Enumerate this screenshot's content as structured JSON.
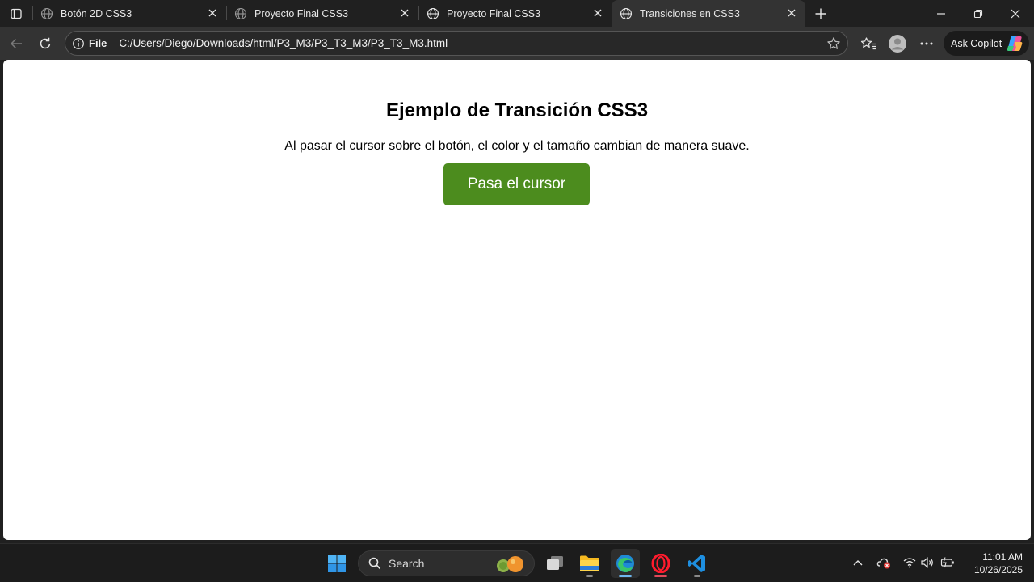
{
  "browser": {
    "tabs": [
      {
        "title": "Botón 2D CSS3",
        "active": false
      },
      {
        "title": "Proyecto Final CSS3",
        "active": false
      },
      {
        "title": "Proyecto Final CSS3",
        "active": false
      },
      {
        "title": "Transiciones en CSS3",
        "active": true
      }
    ],
    "address": {
      "scheme_label": "File",
      "url": "C:/Users/Diego/Downloads/html/P3_M3/P3_T3_M3/P3_T3_M3.html"
    },
    "copilot_label": "Ask Copilot"
  },
  "page": {
    "heading": "Ejemplo de Transición CSS3",
    "description": "Al pasar el cursor sobre el botón, el color y el tamaño cambian de manera suave.",
    "button_label": "Pasa el cursor",
    "button_color": "#4c8c1e"
  },
  "taskbar": {
    "search_placeholder": "Search",
    "time": "11:01 AM",
    "date": "10/26/2025"
  }
}
